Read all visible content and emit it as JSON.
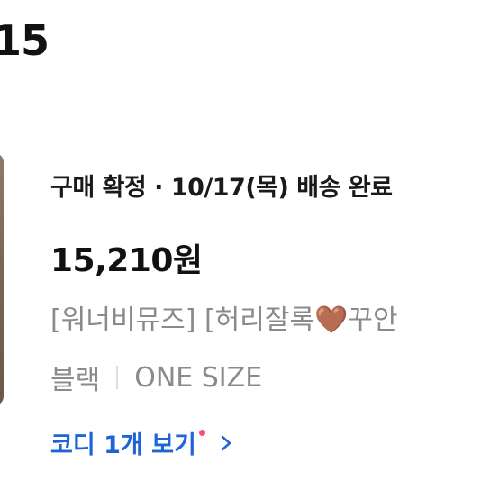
{
  "header": {
    "date_fragment": "15"
  },
  "order": {
    "status": "구매 확정 · 10/17(목) 배송 완료",
    "price": "15,210원",
    "product_prefix": "[워너비뮤즈] [허리잘록",
    "product_emoji": "🤎",
    "product_suffix": "꾸안",
    "option_color": "블랙",
    "option_size": "ONE SIZE",
    "coordi_link": "코디 1개 보기"
  },
  "colors": {
    "link_blue": "#1f63d9",
    "notification_dot": "#ff4d6d"
  }
}
